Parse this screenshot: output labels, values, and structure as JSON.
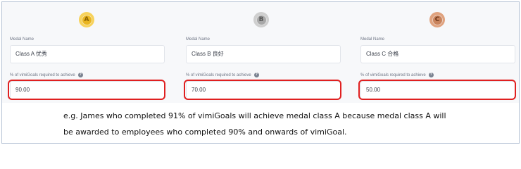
{
  "medals": [
    {
      "letter": "A",
      "colors": {
        "outer": "#f7d25a",
        "inner": "#e9b520",
        "letter": "#8a6200"
      },
      "name_label": "Medal Name",
      "name_value": "Class A 优秀",
      "pct_label": "% of vimiGoals required to achieve",
      "pct_value": "90.00"
    },
    {
      "letter": "B",
      "colors": {
        "outer": "#cfcfcf",
        "inner": "#a8a8a8",
        "letter": "#555555"
      },
      "name_label": "Medal Name",
      "name_value": "Class B 良好",
      "pct_label": "% of vimiGoals required to achieve",
      "pct_value": "70.00"
    },
    {
      "letter": "C",
      "colors": {
        "outer": "#e0a27e",
        "inner": "#c9835c",
        "letter": "#6b3518"
      },
      "name_label": "Medal Name",
      "name_value": "Class C 合格",
      "pct_label": "% of vimiGoals required to achieve",
      "pct_value": "50.00"
    }
  ],
  "help_icon": "question-circle-icon",
  "highlight_color": "#e02020",
  "description": {
    "line1": "e.g. James who completed 91% of vimiGoals will achieve medal class A because medal class A will",
    "line2": "be awarded to employees who completed 90% and onwards of vimiGoal."
  }
}
